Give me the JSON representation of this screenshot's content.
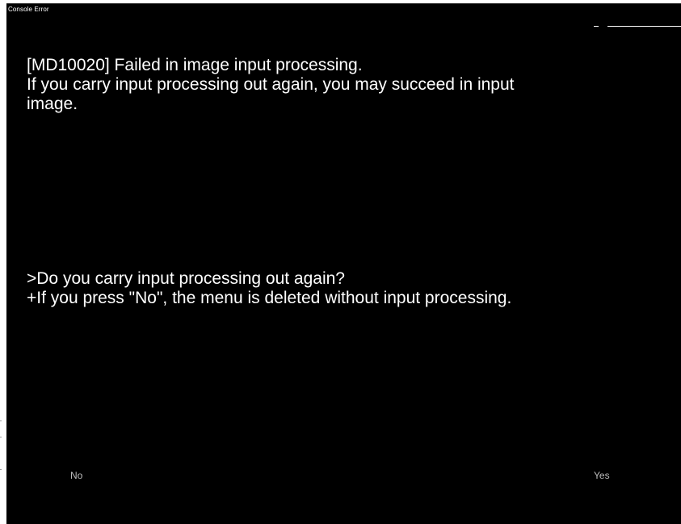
{
  "window": {
    "title": "Console Error"
  },
  "error": {
    "line1": "[MD10020] Failed in image input processing.",
    "line2": "If you carry input processing out again, you may succeed in input",
    "line3": "image."
  },
  "prompt": {
    "question": ">Do you carry input processing out again?",
    "note": "+If you press \"No\", the menu is deleted without input processing."
  },
  "buttons": {
    "no_label": "No",
    "yes_label": "Yes"
  },
  "colors": {
    "background": "#000000",
    "text": "#ffffff",
    "button_text": "#bcbcbc"
  }
}
